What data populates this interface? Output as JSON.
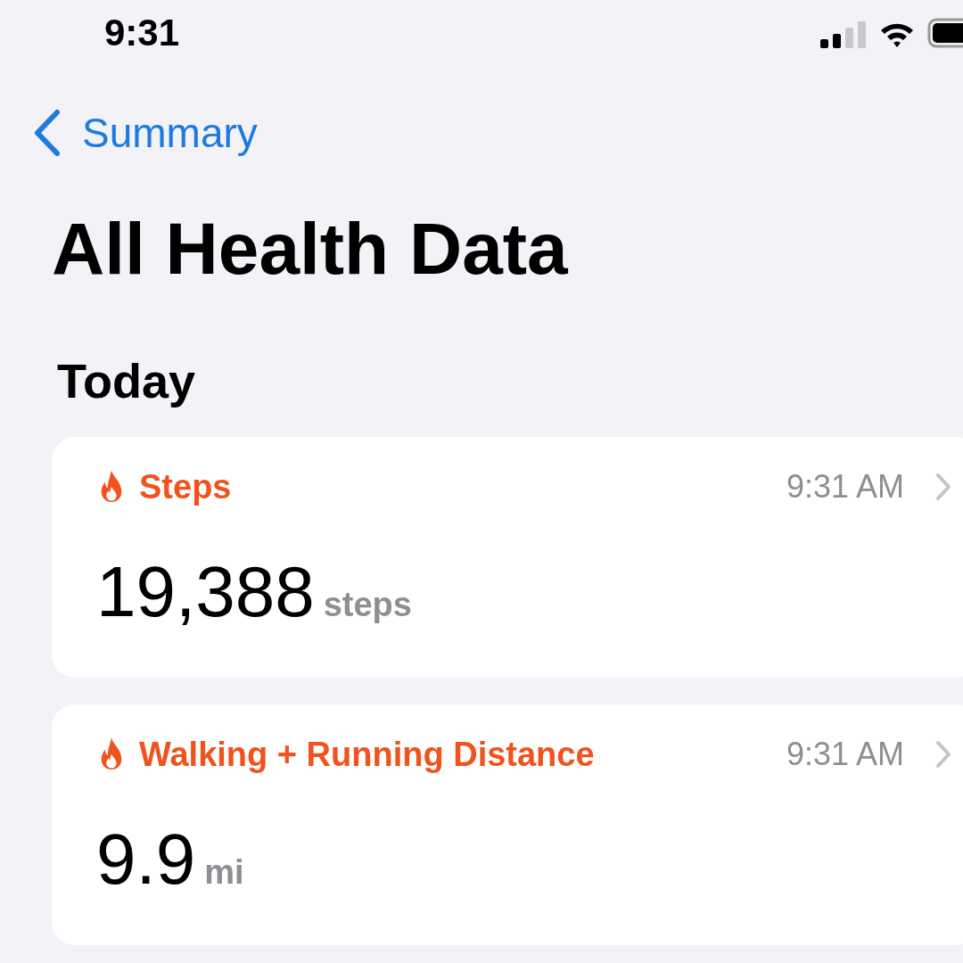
{
  "status_bar": {
    "time": "9:31"
  },
  "nav": {
    "back_label": "Summary"
  },
  "title": "All Health Data",
  "section": "Today",
  "cards": [
    {
      "label": "Steps",
      "time": "9:31 AM",
      "value": "19,388",
      "unit": "steps"
    },
    {
      "label": "Walking + Running Distance",
      "time": "9:31 AM",
      "value": "9.9",
      "unit": "mi"
    }
  ]
}
